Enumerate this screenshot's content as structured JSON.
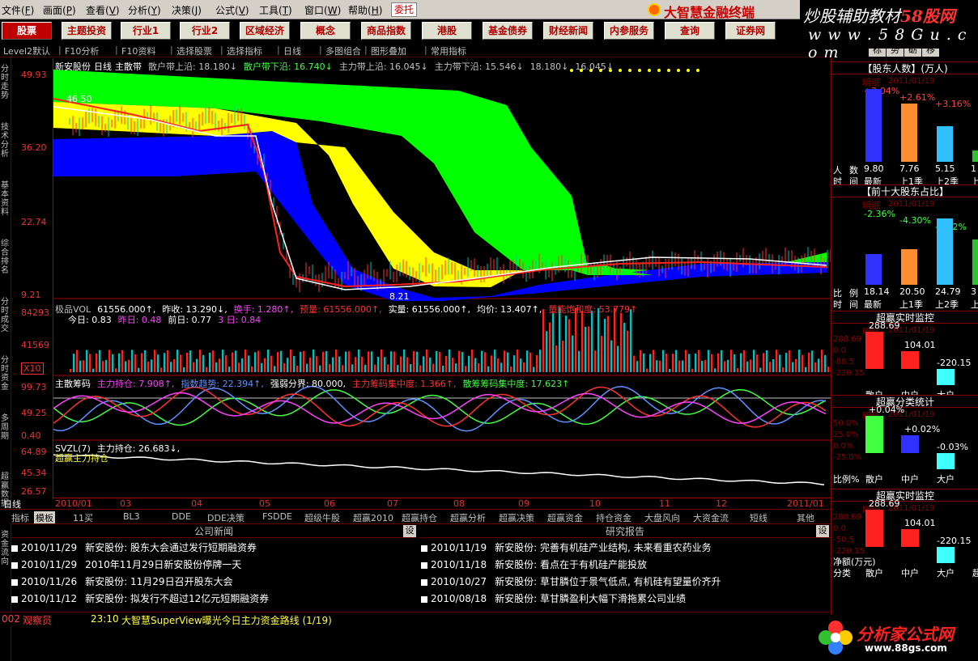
{
  "menu": {
    "items": [
      {
        "label": "文件",
        "key": "F"
      },
      {
        "label": "画面",
        "key": "P"
      },
      {
        "label": "查看",
        "key": "V"
      },
      {
        "label": "分析",
        "key": "Y"
      },
      {
        "label": "决策",
        "key": "J"
      },
      {
        "label": "公式",
        "key": "V"
      },
      {
        "label": "工具",
        "key": "T"
      },
      {
        "label": "窗口",
        "key": "W"
      },
      {
        "label": "帮助",
        "key": "H"
      }
    ],
    "weituo": "委托",
    "brand": "大智慧金融终端"
  },
  "watermark": {
    "line1a": "炒股辅助教材",
    "line1b": "58股网",
    "line2": "w w w . 5 8 G u . c o m"
  },
  "nav": [
    "股票",
    "主题投资",
    "行业1",
    "行业2",
    "区域经济",
    "概念",
    "商品指数",
    "港股",
    "基金债券",
    "财经新闻",
    "内参服务",
    "查询",
    "证券网"
  ],
  "toolbar": [
    "Level2默认",
    "F10分析",
    "F10资料",
    "选择股票",
    "选择指标",
    "日线",
    "多图组合",
    "图形叠加",
    "常用指标"
  ],
  "right_tabs": [
    "标",
    "势",
    "砺",
    "移"
  ],
  "left_strip": [
    "分时走势",
    "技术分析",
    "基本资料",
    "综合排名",
    "分时成交",
    "分时资金",
    "多周期",
    "超赢数据",
    "资金流向"
  ],
  "main_chart": {
    "legend": {
      "name": "新安股份",
      "period": "日线",
      "indicator": "主散带",
      "items": [
        {
          "label": "散户带上沿: 18.180↓",
          "color": "#c0c0c0"
        },
        {
          "label": "散户带下沿: 16.740↓",
          "color": "#40ff40"
        },
        {
          "label": "主力带上沿: 16.045↓",
          "color": "#c0c0c0"
        },
        {
          "label": "主力带下沿: 15.546↓",
          "color": "#c0c0c0"
        },
        {
          "label": "18.180↓",
          "color": "#c0c0c0"
        },
        {
          "label": "16.045↓",
          "color": "#c0c0c0"
        }
      ],
      "hi_marker": "46.50",
      "lo_marker": "8.21"
    },
    "y_labels": [
      "49.93",
      "36.20",
      "22.74",
      "9.21"
    ]
  },
  "volume": {
    "legend": [
      {
        "label": "极品VOL",
        "color": "#c0c0c0"
      },
      {
        "label": "61556.000↑,",
        "color": "#fff"
      },
      {
        "label": "昨收: 13.290↓,",
        "color": "#fff"
      },
      {
        "label": "换手: 1.280↑,",
        "color": "#ff40ff"
      },
      {
        "label": "预量: 61556.000↑,",
        "color": "#ff3030"
      },
      {
        "label": "实量: 61556.000↑,",
        "color": "#fff"
      },
      {
        "label": "均价: 13.407↑,",
        "color": "#fff"
      },
      {
        "label": "量能饱和度: 53.779↑",
        "color": "#ff3030"
      }
    ],
    "sub": [
      {
        "label": "今日: 0.83",
        "color": "#fff"
      },
      {
        "label": "昨日: 0.48",
        "color": "#ff40ff"
      },
      {
        "label": "前日: 0.77",
        "color": "#fff"
      },
      {
        "label": "3 日: 0.84",
        "color": "#ff40ff"
      }
    ],
    "y_labels": [
      "84293",
      "41569",
      "X10"
    ]
  },
  "chips": {
    "legend": [
      {
        "label": "主散筹码",
        "color": "#fff"
      },
      {
        "label": "主力持仓: 7.908↑,",
        "color": "#ff40ff"
      },
      {
        "label": "指数趋势: 22.394↑,",
        "color": "#6090ff"
      },
      {
        "label": "强弱分界: 80.000,",
        "color": "#fff"
      },
      {
        "label": "主力筹码集中度: 1.366↑,",
        "color": "#ff3030"
      },
      {
        "label": "散筹筹码集中度: 17.623↑",
        "color": "#40ff40"
      }
    ],
    "y_labels": [
      "99.73",
      "49.25",
      "0.40"
    ]
  },
  "svzl": {
    "legend": [
      {
        "label": "SVZL(7)",
        "color": "#fff"
      },
      {
        "label": "主力持仓: 26.683↓,",
        "color": "#fff"
      }
    ],
    "note": "超赢主力持仓",
    "y_labels": [
      "64.89",
      "45.34",
      "26.57"
    ]
  },
  "x_labels": [
    "2010/01",
    "03",
    "04",
    "05",
    "06",
    "07",
    "08",
    "09",
    "10",
    "11",
    "12",
    "2011/01"
  ],
  "period_label": "日线",
  "bottom_tabs": [
    "指标",
    "模板",
    "11买",
    "BL3",
    "DDE",
    "DDE决策",
    "FSDDE",
    "超级牛股",
    "超赢2010",
    "超赢持仓",
    "超赢分析",
    "超赢决策",
    "超赢资金",
    "持仓资金",
    "大盘风向",
    "大资金流",
    "短线",
    "其他"
  ],
  "company_news": {
    "title": "公司新闻",
    "rows": [
      {
        "date": "2010/11/29",
        "text": "新安股份: 股东大会通过发行短期融资券"
      },
      {
        "date": "2010/11/29",
        "text": "2010年11月29日新安股份停牌一天"
      },
      {
        "date": "2010/11/26",
        "text": "新安股份: 11月29日召开股东大会"
      },
      {
        "date": "2010/11/12",
        "text": "新安股份: 拟发行不超过12亿元短期融资券"
      }
    ]
  },
  "research": {
    "title": "研究报告",
    "rows": [
      {
        "date": "2010/11/19",
        "text": "新安股份: 完善有机硅产业结构, 未来看重农药业务"
      },
      {
        "date": "2010/11/18",
        "text": "新安股份: 看点在于有机硅产能投放"
      },
      {
        "date": "2010/10/27",
        "text": "新安股份: 草甘膦位于景气低点, 有机硅有望量价齐升"
      },
      {
        "date": "2010/08/18",
        "text": "新安股份: 草甘膦盈利大幅下滑拖累公司业绩"
      }
    ]
  },
  "set_label": "设",
  "status": {
    "code": "002",
    "viewer": "观察员",
    "time": "23:10",
    "ticker": "大智慧SuperView曝光今日主力资金路线 (1/19)"
  },
  "side": {
    "p1": {
      "title": "【股东人数】(万人)",
      "date": "2011/01/19",
      "tag": "明细",
      "pcts": [
        "+2.04%",
        "+2.61%",
        "+3.16%"
      ],
      "bars": [
        {
          "v": "9.80",
          "l": "最新"
        },
        {
          "v": "7.76",
          "l": "上1季"
        },
        {
          "v": "5.15",
          "l": "上2季"
        },
        {
          "v": "1",
          "l": "上"
        }
      ],
      "rowlabels": [
        "人",
        "数",
        "时",
        "间"
      ]
    },
    "p2": {
      "title": "【前十大股东占比】",
      "date": "2011/01/19",
      "tag": "明细",
      "pcts": [
        "-2.36%",
        "-4.30%",
        "-6.42%"
      ],
      "bars": [
        {
          "v": "18.14",
          "l": "最新"
        },
        {
          "v": "20.50",
          "l": "上1季"
        },
        {
          "v": "24.79",
          "l": "上2季"
        },
        {
          "v": "3",
          "l": "上"
        }
      ],
      "rowlabels": [
        "比",
        "例",
        "时",
        "间"
      ]
    },
    "p3": {
      "title": "超赢实时监控",
      "date": "2011/01/19",
      "tag": "明细",
      "axis": [
        "288.69",
        "0.0",
        "-88.5",
        "-220.15"
      ],
      "vals": [
        "288.69",
        "104.01",
        "-220.15"
      ],
      "labels": [
        "散户",
        "中户",
        "大户"
      ]
    },
    "p4": {
      "title": "超赢分类统计",
      "date": "2011/01/19",
      "tag": "明细",
      "axis": [
        "50.0%",
        "25.0%",
        "0.0%",
        "-25.0%"
      ],
      "vals": [
        "+0.04%",
        "+0.02%",
        "-0.03%"
      ],
      "labels": [
        "散户",
        "中户",
        "大户"
      ],
      "rowlabel": "比例%"
    },
    "p5": {
      "title": "超赢实时监控",
      "date": "2011/01/19",
      "tag": "明细",
      "axis": [
        "288.69",
        "0.0",
        "-50.5",
        "-220.15"
      ],
      "vals": [
        "288.69",
        "104.01",
        "-220.15"
      ],
      "labels": [
        "散户",
        "中户",
        "大户",
        "超"
      ],
      "rowlabel": "分类",
      "unit": "净额(万元)"
    }
  },
  "logo": {
    "t1": "分析家公式网",
    "t2": "www.88gs.com"
  },
  "colors": {
    "accent": "#c00000",
    "grid": "#a00000",
    "green": "#00ff00",
    "yellow": "#ffff00",
    "blue": "#0000ff",
    "red": "#ff2020",
    "cyan": "#00c0c0"
  }
}
